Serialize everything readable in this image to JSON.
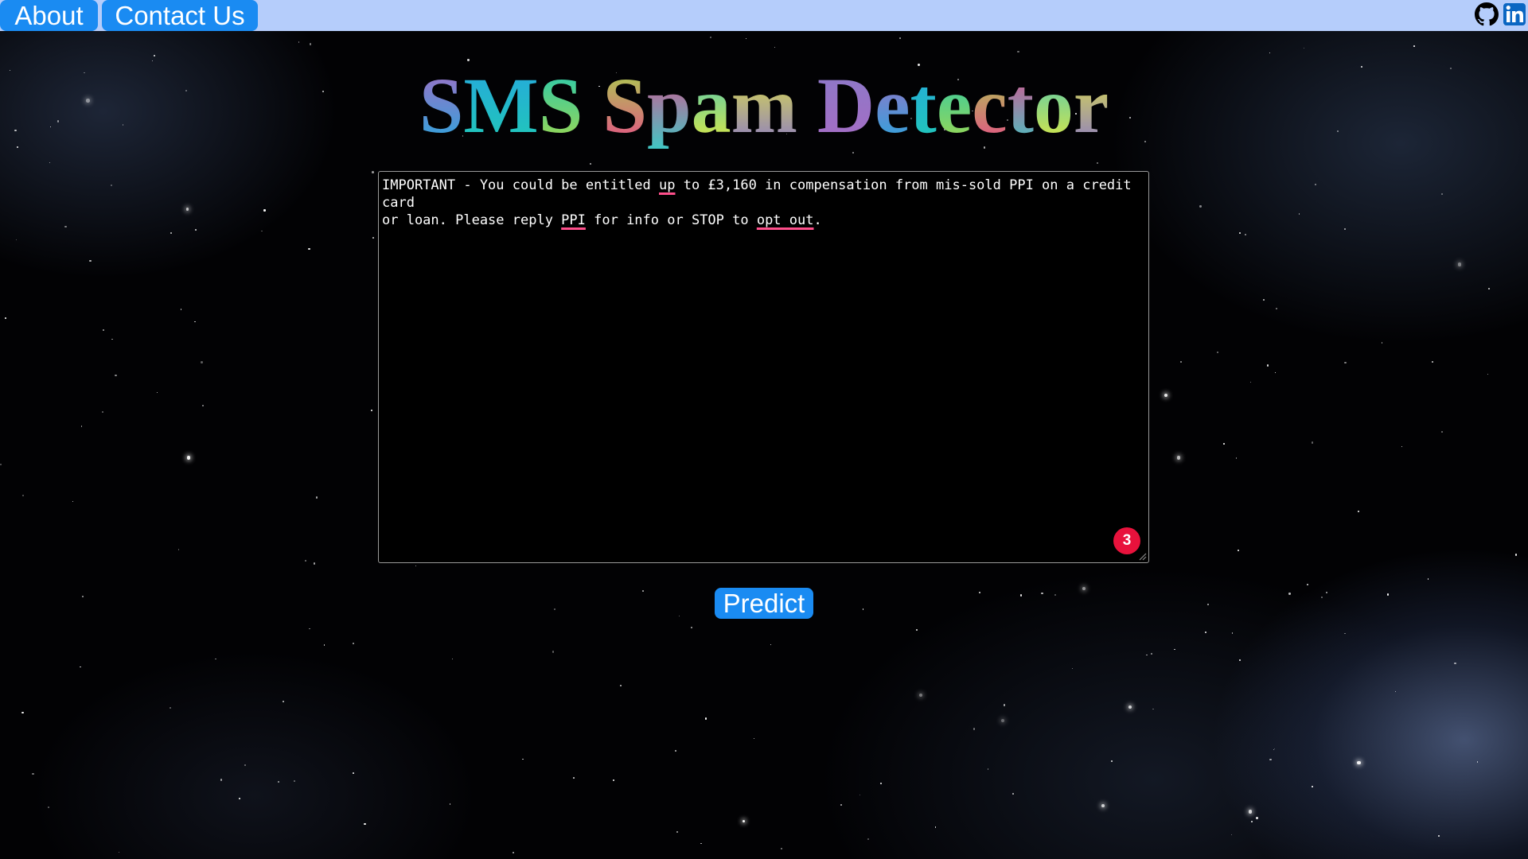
{
  "nav": {
    "about_label": "About",
    "contact_label": "Contact Us",
    "github_icon": "github-icon",
    "linkedin_icon": "linkedin-icon"
  },
  "title": {
    "text": "SMS Spam Detector"
  },
  "message": {
    "line1_part1": "IMPORTANT - You could be entitled ",
    "line1_flag1": "up",
    "line1_part2": " to £3,160 in compensation from mis-sold PPI on a credit card",
    "line2_part1": "or loan. Please reply ",
    "line2_flag1": "PPI",
    "line2_part2": " for info or STOP to ",
    "line2_flag2": "opt out",
    "line2_part3": "."
  },
  "spellcheck_badge": "3",
  "predict_label": "Predict",
  "colors": {
    "navbar": "#b5cdfb",
    "button": "#1a8bf2",
    "badge": "#e8123c",
    "title_gradient": [
      "#a76cc4",
      "#26a8de",
      "#20c9b6",
      "#a5d84a",
      "#e8488a",
      "#3fc7c4",
      "#e4e83c",
      "#8a7ac9"
    ]
  }
}
